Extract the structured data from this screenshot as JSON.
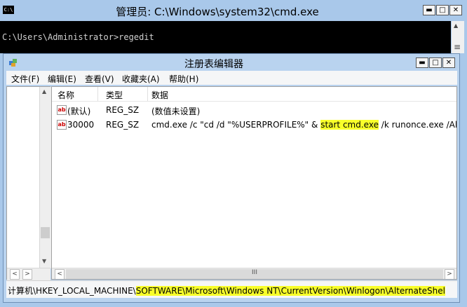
{
  "cmd": {
    "title": "管理员: C:\\Windows\\system32\\cmd.exe",
    "icon_label": "C:\\",
    "prompt_line": "C:\\Users\\Administrator>regedit",
    "controls": {
      "minimize": "▬",
      "maximize": "□",
      "close": "✕"
    }
  },
  "regedit": {
    "title": "注册表编辑器",
    "controls": {
      "minimize": "▬",
      "maximize": "□",
      "close": "✕"
    },
    "menu": [
      "文件(F)",
      "编辑(E)",
      "查看(V)",
      "收藏夹(A)",
      "帮助(H)"
    ],
    "columns": [
      "名称",
      "类型",
      "数据"
    ],
    "rows": [
      {
        "name": "(默认)",
        "type": "REG_SZ",
        "data_pre": "(数值未设置)",
        "data_hl": "",
        "data_post": ""
      },
      {
        "name": "30000",
        "type": "REG_SZ",
        "data_pre": "cmd.exe /c \"cd /d \"%USERPROFILE%\" & ",
        "data_hl": "start cmd.exe",
        "data_post": " /k runonce.exe /Alte"
      }
    ],
    "icon_label": "ab",
    "status_prefix": "计算机\\HKEY_LOCAL_MACHINE\\",
    "status_highlight": "SOFTWARE\\Microsoft\\Windows NT\\CurrentVersion\\Winlogon\\AlternateShel",
    "scroll_glyphs": {
      "up": "▲",
      "down": "▼",
      "left": "<",
      "right": ">",
      "grip": "III",
      "menu": "≡"
    }
  },
  "colors": {
    "highlight": "#f8ff2a",
    "console_bg": "#000000",
    "frame": "#a9c8ea"
  }
}
